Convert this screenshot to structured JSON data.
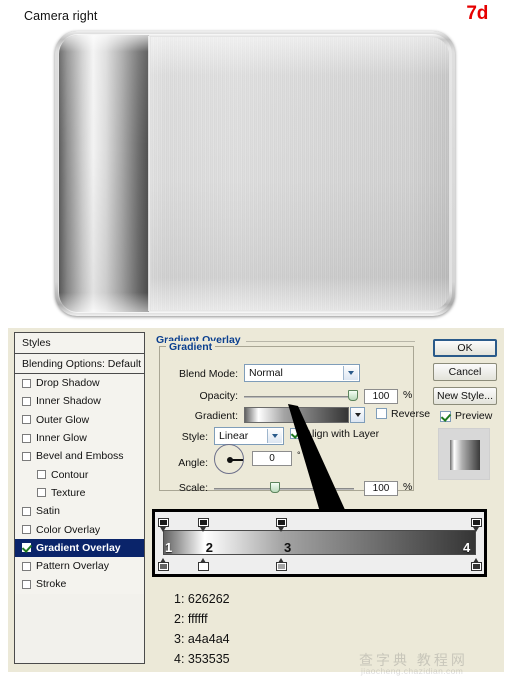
{
  "header": {
    "title": "Camera right",
    "step": "7d"
  },
  "artwork": {
    "name": "camera-body-render",
    "left_panel_label": "dark-metal-side-panel",
    "face_label": "brushed-metal-front-face"
  },
  "dialog": {
    "styles_panel": {
      "header": "Styles",
      "blending_options": "Blending Options: Default",
      "items": [
        {
          "label": "Drop Shadow",
          "checked": false,
          "indent": false,
          "selected": false
        },
        {
          "label": "Inner Shadow",
          "checked": false,
          "indent": false,
          "selected": false
        },
        {
          "label": "Outer Glow",
          "checked": false,
          "indent": false,
          "selected": false
        },
        {
          "label": "Inner Glow",
          "checked": false,
          "indent": false,
          "selected": false
        },
        {
          "label": "Bevel and Emboss",
          "checked": false,
          "indent": false,
          "selected": false
        },
        {
          "label": "Contour",
          "checked": false,
          "indent": true,
          "selected": false
        },
        {
          "label": "Texture",
          "checked": false,
          "indent": true,
          "selected": false
        },
        {
          "label": "Satin",
          "checked": false,
          "indent": false,
          "selected": false
        },
        {
          "label": "Color Overlay",
          "checked": false,
          "indent": false,
          "selected": false
        },
        {
          "label": "Gradient Overlay",
          "checked": true,
          "indent": false,
          "selected": true
        },
        {
          "label": "Pattern Overlay",
          "checked": false,
          "indent": false,
          "selected": false
        },
        {
          "label": "Stroke",
          "checked": false,
          "indent": false,
          "selected": false
        }
      ]
    },
    "main": {
      "pane_title": "Gradient Overlay",
      "group_title": "Gradient",
      "blend_mode_label": "Blend Mode:",
      "blend_mode_value": "Normal",
      "opacity_label": "Opacity:",
      "opacity_value": "100",
      "opacity_unit": "%",
      "gradient_label": "Gradient:",
      "reverse_label": "Reverse",
      "reverse_checked": false,
      "style_label": "Style:",
      "style_value": "Linear",
      "align_label": "Align with Layer",
      "align_checked": true,
      "angle_label": "Angle:",
      "angle_value": "0",
      "angle_unit": "°",
      "scale_label": "Scale:",
      "scale_value": "100",
      "scale_unit": "%"
    },
    "buttons": {
      "ok": "OK",
      "cancel": "Cancel",
      "new_style": "New Style...",
      "preview": "Preview",
      "preview_checked": true
    }
  },
  "gradient_editor": {
    "stop_numbers": [
      "1",
      "2",
      "3",
      "4"
    ],
    "stop_positions_pct": [
      0,
      13,
      38,
      100
    ],
    "stop_colors": [
      "#626262",
      "#ffffff",
      "#a4a4a4",
      "#353535"
    ],
    "legend": [
      "1: 626262",
      "2: ffffff",
      "3: a4a4a4",
      "4: 353535"
    ]
  },
  "watermark": {
    "cn": "查字典 教程网",
    "en": "jiaocheng.chazidian.com"
  }
}
